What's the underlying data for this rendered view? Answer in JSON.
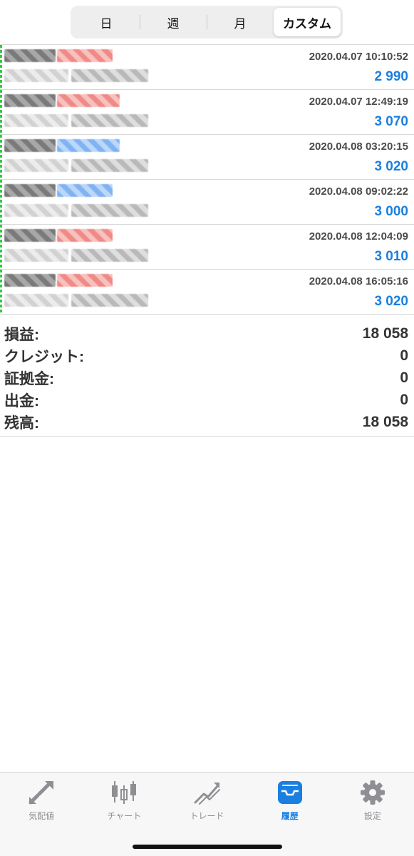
{
  "segments": [
    {
      "label": "日",
      "active": false
    },
    {
      "label": "週",
      "active": false
    },
    {
      "label": "月",
      "active": false
    },
    {
      "label": "カスタム",
      "active": true
    }
  ],
  "deals": [
    {
      "time": "2020.04.07 10:10:52",
      "profit": "2 990",
      "side_color": "red"
    },
    {
      "time": "2020.04.07 12:49:19",
      "profit": "3 070",
      "side_color": "red"
    },
    {
      "time": "2020.04.08 03:20:15",
      "profit": "3 020",
      "side_color": "blue"
    },
    {
      "time": "2020.04.08 09:02:22",
      "profit": "3 000",
      "side_color": "blue"
    },
    {
      "time": "2020.04.08 12:04:09",
      "profit": "3 010",
      "side_color": "red"
    },
    {
      "time": "2020.04.08 16:05:16",
      "profit": "3 020",
      "side_color": "red"
    }
  ],
  "summary": [
    {
      "label": "損益:",
      "value": "18 058"
    },
    {
      "label": "クレジット:",
      "value": "0"
    },
    {
      "label": "証拠金:",
      "value": "0"
    },
    {
      "label": "出金:",
      "value": "0"
    },
    {
      "label": "残高:",
      "value": "18 058"
    }
  ],
  "tabs": [
    {
      "label": "気配値",
      "icon": "quotes-arrows-icon",
      "active": false
    },
    {
      "label": "チャート",
      "icon": "candlestick-icon",
      "active": false
    },
    {
      "label": "トレード",
      "icon": "trade-trend-icon",
      "active": false
    },
    {
      "label": "履歴",
      "icon": "history-inbox-icon",
      "active": true
    },
    {
      "label": "設定",
      "icon": "gear-icon",
      "active": false
    }
  ],
  "colors": {
    "accent": "#1a7fe0",
    "inactive": "#8e8e93",
    "buy_edge": "#2ecc40"
  }
}
